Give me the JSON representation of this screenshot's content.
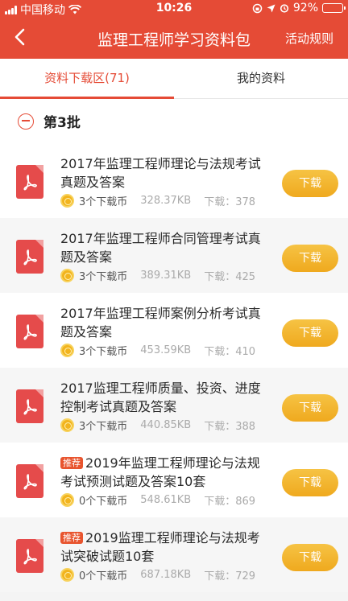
{
  "status_bar": {
    "carrier": "中国移动",
    "time": "10:26",
    "battery": "92%",
    "battery_level": 0.92
  },
  "header": {
    "title": "监理工程师学习资料包",
    "rules_label": "活动规则"
  },
  "tabs": [
    {
      "label": "资料下载区(71)",
      "active": true
    },
    {
      "label": "我的资料",
      "active": false
    }
  ],
  "batch": {
    "title": "第3批"
  },
  "items": [
    {
      "tag": "",
      "title": "2017年监理工程师理论与法规考试真题及答案",
      "cost": "3个下载币",
      "size": "328.37KB",
      "downloads": "下载：378",
      "button": "下载"
    },
    {
      "tag": "",
      "title": "2017年监理工程师合同管理考试真题及答案",
      "cost": "3个下载币",
      "size": "389.31KB",
      "downloads": "下载：425",
      "button": "下载"
    },
    {
      "tag": "",
      "title": "2017年监理工程师案例分析考试真题及答案",
      "cost": "3个下载币",
      "size": "453.59KB",
      "downloads": "下载：410",
      "button": "下载"
    },
    {
      "tag": "",
      "title": "2017监理工程师质量、投资、进度控制考试真题及答案",
      "cost": "3个下载币",
      "size": "440.85KB",
      "downloads": "下载：388",
      "button": "下载"
    },
    {
      "tag": "推荐",
      "title": "2019年监理工程师理论与法规考试预测试题及答案10套",
      "cost": "0个下载币",
      "size": "548.61KB",
      "downloads": "下载：869",
      "button": "下载"
    },
    {
      "tag": "推荐",
      "title": "2019监理工程师理论与法规考试突破试题10套",
      "cost": "0个下载币",
      "size": "687.18KB",
      "downloads": "下载：729",
      "button": "下载"
    }
  ],
  "colors": {
    "brand": "#e54b36",
    "button": "#f2b52f"
  }
}
